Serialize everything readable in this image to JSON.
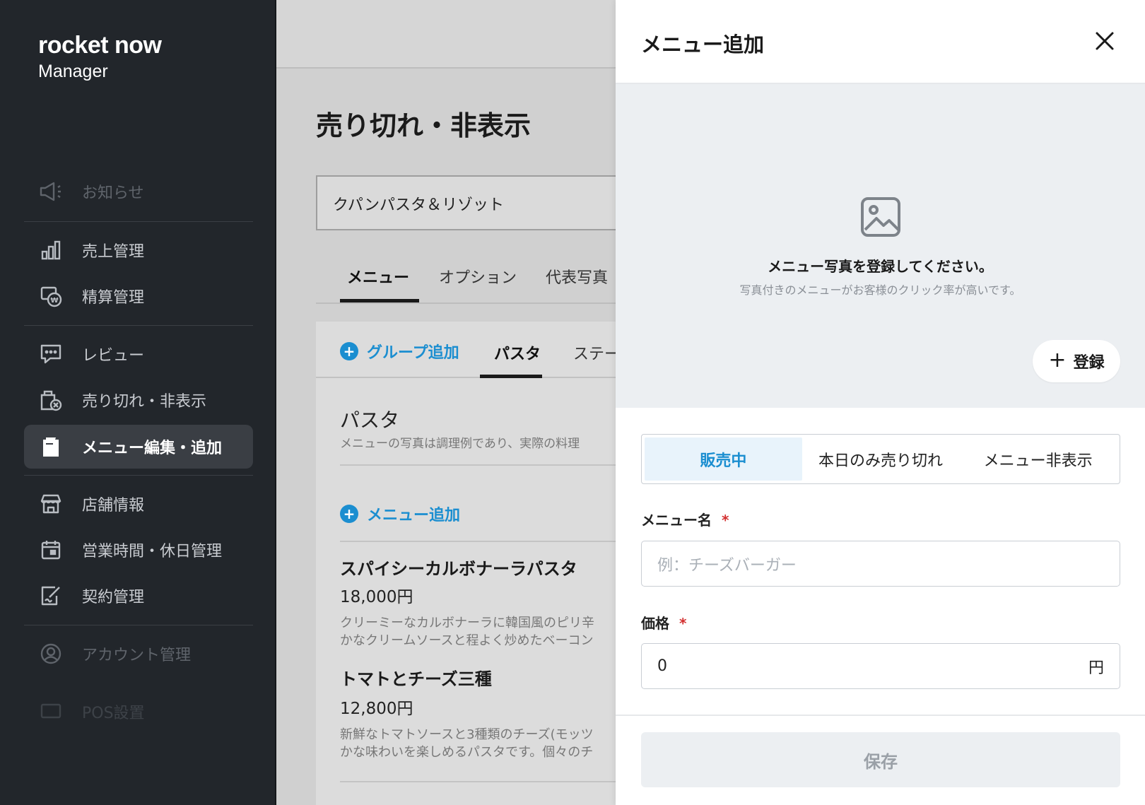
{
  "sidebar": {
    "brand": "rocket now",
    "brand_sub": "Manager",
    "items": [
      {
        "label": "お知らせ",
        "icon": "megaphone-icon"
      },
      {
        "label": "売上管理",
        "icon": "bar-chart-icon"
      },
      {
        "label": "精算管理",
        "icon": "settlement-icon"
      },
      {
        "label": "レビュー",
        "icon": "review-chat-icon"
      },
      {
        "label": "売り切れ・非表示",
        "icon": "soldout-icon"
      },
      {
        "label": "メニュー編集・追加",
        "icon": "menu-book-icon"
      },
      {
        "label": "店舗情報",
        "icon": "store-icon"
      },
      {
        "label": "営業時間・休日管理",
        "icon": "calendar-icon"
      },
      {
        "label": "契約管理",
        "icon": "contract-icon"
      },
      {
        "label": "アカウント管理",
        "icon": "account-icon"
      },
      {
        "label": "POS設置",
        "icon": "pos-icon"
      }
    ]
  },
  "main": {
    "title": "売り切れ・非表示",
    "store": "クパンパスタ＆リゾット",
    "tabs": [
      "メニュー",
      "オプション",
      "代表写真"
    ],
    "group_add": "グループ追加",
    "group_tabs": [
      "パスタ",
      "ステー"
    ],
    "section_title": "パスタ",
    "section_note": "メニューの写真は調理例であり、実際の料理",
    "menu_add": "メニュー追加",
    "items": [
      {
        "name": "スパイシーカルボナーラパスタ",
        "price": "18,000円",
        "desc1": "クリーミーなカルボナーラに韓国風のピリ辛",
        "desc2": "かなクリームソースと程よく炒めたベーコン"
      },
      {
        "name": "トマトとチーズ三種",
        "price": "12,800円",
        "desc1": "新鮮なトマトソースと3種類のチーズ(モッツ",
        "desc2": "かな味わいを楽しめるパスタです。個々のチ"
      }
    ]
  },
  "drawer": {
    "title": "メニュー追加",
    "photo_title": "メニュー写真を登録してください。",
    "photo_sub": "写真付きのメニューがお客様のクリック率が高いです。",
    "register_label": "登録",
    "status_options": [
      "販売中",
      "本日のみ売り切れ",
      "メニュー非表示"
    ],
    "name_label": "メニュー名",
    "name_placeholder": "例：チーズバーガー",
    "price_label": "価格",
    "price_value": "0",
    "price_unit": "円",
    "required_mark": "*",
    "save_label": "保存"
  },
  "colors": {
    "sidebar_bg": "#22262b",
    "accent_blue": "#1b8ed0",
    "required_red": "#d32f2f"
  }
}
